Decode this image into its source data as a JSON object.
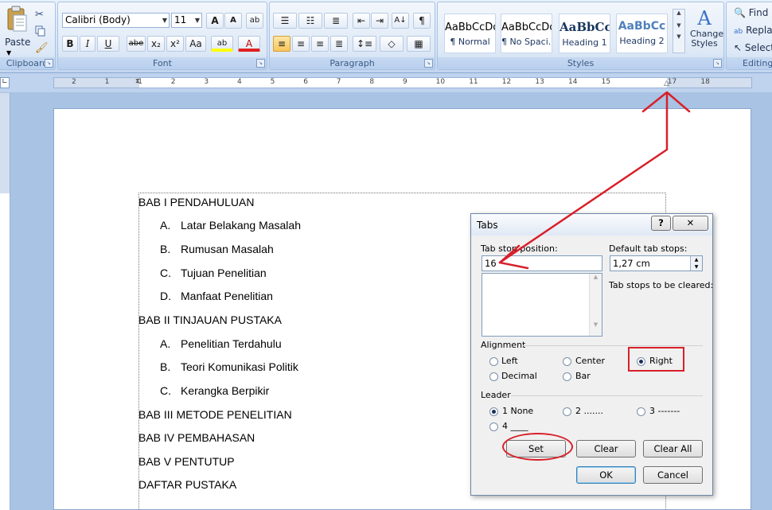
{
  "ribbon": {
    "clipboard": {
      "paste_label": "Paste",
      "group_label": "Clipboard"
    },
    "font": {
      "font_name": "Calibri (Body)",
      "font_size": "11",
      "group_label": "Font",
      "grow_label": "A",
      "shrink_label": "A",
      "clear_label": "ab",
      "bold": "B",
      "italic": "I",
      "underline": "U",
      "strike": "abe",
      "subscript": "x₂",
      "superscript": "x²",
      "case": "Aa",
      "highlight": "ab",
      "color": "A"
    },
    "paragraph": {
      "group_label": "Paragraph",
      "sort": "A↓",
      "pilcrow": "¶"
    },
    "styles": {
      "group_label": "Styles",
      "change_label": "Change\nStyles",
      "items": [
        {
          "sample": "AaBbCcDc",
          "name": "¶ Normal"
        },
        {
          "sample": "AaBbCcDc",
          "name": "¶ No Spaci..."
        },
        {
          "sample": "AaBbCc",
          "name": "Heading 1"
        },
        {
          "sample": "AaBbCc",
          "name": "Heading 2"
        }
      ]
    },
    "editing": {
      "group_label": "Editing",
      "find": "Find",
      "replace": "Replace",
      "select": "Select"
    }
  },
  "ruler": {
    "ticks": [
      "2",
      "1",
      "1",
      "2",
      "3",
      "4",
      "5",
      "6",
      "7",
      "8",
      "9",
      "10",
      "11",
      "12",
      "13",
      "14",
      "15",
      "17",
      "18"
    ]
  },
  "document": {
    "lines": [
      "BAB I PENDAHULUAN",
      "A.",
      "Latar Belakang Masalah",
      "B.",
      "Rumusan Masalah",
      "C.",
      "Tujuan Penelitian",
      "D.",
      "Manfaat Penelitian",
      "BAB II TINJAUAN  PUSTAKA",
      "A.",
      "Penelitian Terdahulu",
      "B.",
      "Teori Komunikasi  Politik",
      "C.",
      "Kerangka Berpikir",
      "BAB III METODE PENELITIAN",
      "BAB IV PEMBAHASAN",
      "BAB V PENTUTUP",
      "DAFTAR PUSTAKA"
    ]
  },
  "dialog": {
    "title": "Tabs",
    "help": "?",
    "close": "✕",
    "tab_stop_label": "Tab stop position:",
    "tab_stop_value": "16",
    "default_label": "Default tab stops:",
    "default_value": "1,27 cm",
    "cleared_label": "Tab stops to be cleared:",
    "alignment_label": "Alignment",
    "alignment": {
      "left": "Left",
      "center": "Center",
      "right": "Right",
      "decimal": "Decimal",
      "bar": "Bar",
      "selected": "Right"
    },
    "leader_label": "Leader",
    "leader": {
      "opt1": "1 None",
      "opt2": "2 .......",
      "opt3": "3 -------",
      "opt4": "4 ____",
      "selected": "1 None"
    },
    "buttons": {
      "set": "Set",
      "clear": "Clear",
      "clear_all": "Clear All",
      "ok": "OK",
      "cancel": "Cancel"
    }
  },
  "colors": {
    "annotation": "#d8202a",
    "ribbon": "#d3e3f6",
    "dialog": "#f0f0f0"
  }
}
